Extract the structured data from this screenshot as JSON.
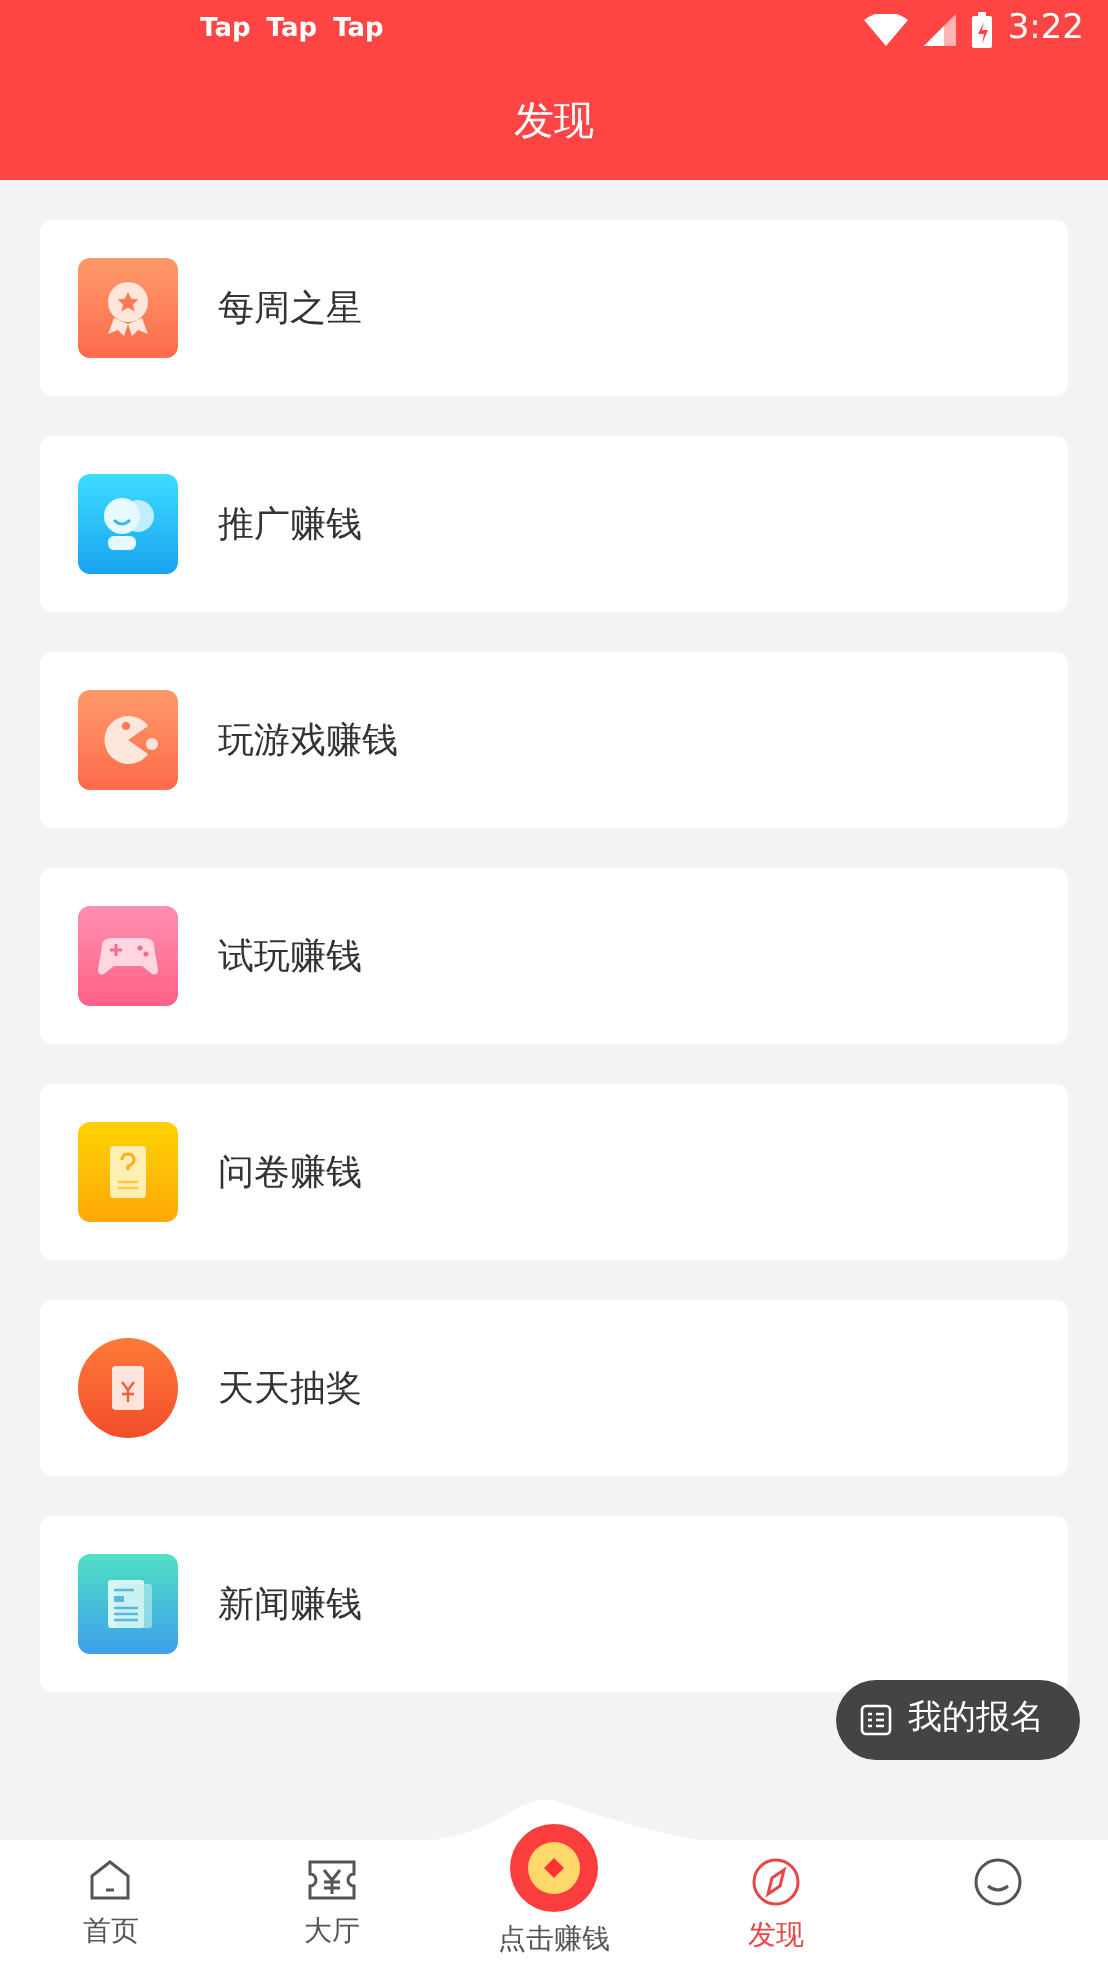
{
  "status_bar": {
    "notifications": [
      "Tap",
      "Tap",
      "Tap"
    ],
    "time": "3:22"
  },
  "header": {
    "title": "发现"
  },
  "items": [
    {
      "kind": "medal",
      "label": "每周之星"
    },
    {
      "kind": "chat",
      "label": "推广赚钱"
    },
    {
      "kind": "game",
      "label": "玩游戏赚钱"
    },
    {
      "kind": "gamepad",
      "label": "试玩赚钱"
    },
    {
      "kind": "survey",
      "label": "问卷赚钱"
    },
    {
      "kind": "lottery",
      "label": "天天抽奖"
    },
    {
      "kind": "news",
      "label": "新闻赚钱"
    }
  ],
  "floating_button": {
    "label": "我的报名"
  },
  "tabs": [
    {
      "kind": "home",
      "label": "首页",
      "selected": false
    },
    {
      "kind": "hall",
      "label": "大厅",
      "selected": false
    },
    {
      "kind": "earn",
      "label": "点击赚钱",
      "selected": false
    },
    {
      "kind": "discover",
      "label": "发现",
      "selected": true
    },
    {
      "kind": "profile",
      "selected": false
    }
  ]
}
